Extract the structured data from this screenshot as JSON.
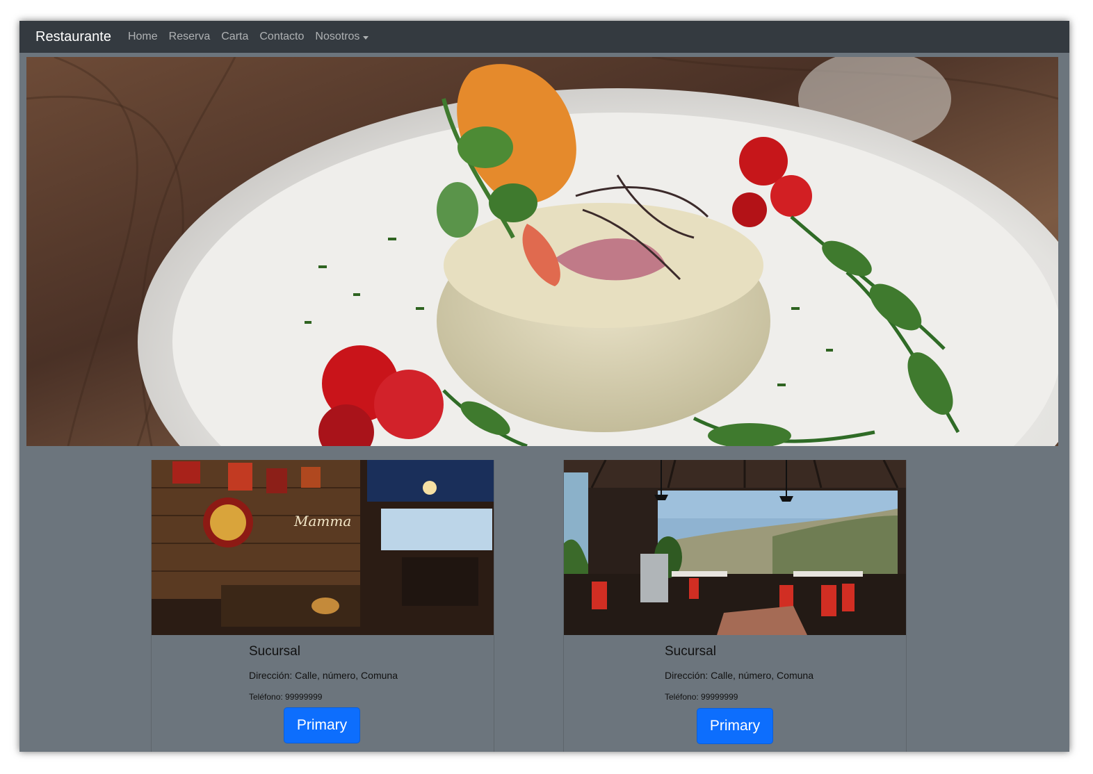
{
  "navbar": {
    "brand": "Restaurante",
    "links": [
      "Home",
      "Reserva",
      "Carta",
      "Contacto"
    ],
    "dropdown_label": "Nosotros"
  },
  "hero": {
    "image": "plated-dish-photo"
  },
  "cards": [
    {
      "image": "restaurant-interior-photo",
      "title": "Sucursal",
      "address": "Dirección: Calle, número, Comuna",
      "phone": "Teléfono: 99999999",
      "button_label": "Primary"
    },
    {
      "image": "terrace-view-photo",
      "title": "Sucursal",
      "address": "Dirección: Calle, número, Comuna",
      "phone": "Teléfono: 99999999",
      "button_label": "Primary"
    }
  ],
  "colors": {
    "navbar_bg": "#343a40",
    "page_bg": "#6c757d",
    "button_primary": "#0d6efd"
  }
}
